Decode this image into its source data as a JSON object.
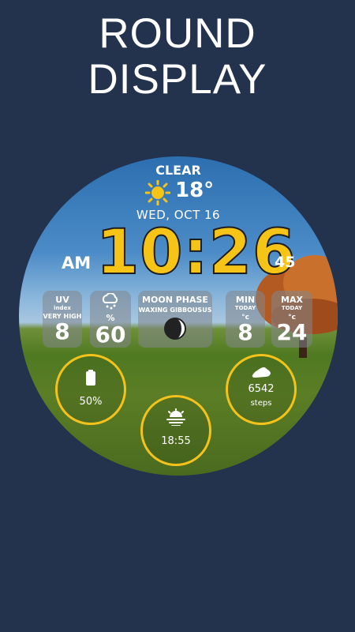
{
  "headline": {
    "line1": "ROUND",
    "line2": "DISPLAY"
  },
  "weather": {
    "condition": "CLEAR",
    "temperature": "18°"
  },
  "date": "WED, OCT 16",
  "clock": {
    "time": "10:26",
    "ampm": "AM",
    "seconds": "45"
  },
  "uv": {
    "title": "UV",
    "sub": "index",
    "level": "VERY HIGH",
    "value": "8"
  },
  "rain": {
    "unit": "%",
    "value": "60"
  },
  "moon": {
    "title": "MOON PHASE",
    "phase": "WAXING GIBBOUSUS"
  },
  "min": {
    "title": "MIN",
    "sub": "TODAY",
    "unit": "°c",
    "value": "8"
  },
  "max": {
    "title": "MAX",
    "sub": "TODAY",
    "unit": "°c",
    "value": "24"
  },
  "battery": {
    "value": "50%"
  },
  "sunset": {
    "value": "18:55"
  },
  "steps": {
    "value": "6542",
    "unit": "steps"
  },
  "colors": {
    "background": "#23324d",
    "accent": "#f4c21a",
    "ring": "#f4c21a"
  }
}
